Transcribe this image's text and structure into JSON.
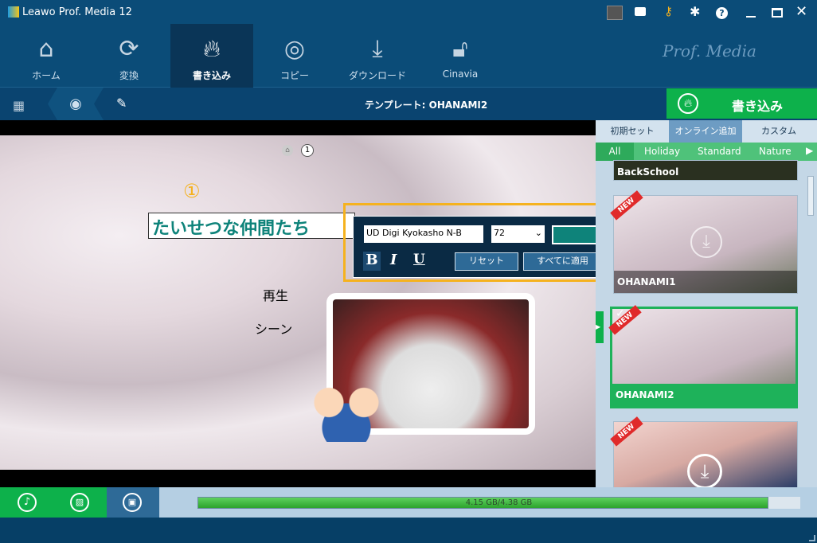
{
  "app": {
    "title": "Leawo Prof. Media 12",
    "brand": "Prof. Media"
  },
  "titlebar_icons": [
    "amd-badge-icon",
    "feedback-icon",
    "key-icon",
    "gear-icon",
    "help-icon",
    "minimize-icon",
    "maximize-icon",
    "close-icon"
  ],
  "nav": [
    {
      "label": "ホーム",
      "icon": "home-icon"
    },
    {
      "label": "変換",
      "icon": "convert-icon"
    },
    {
      "label": "書き込み",
      "icon": "burn-icon",
      "active": true
    },
    {
      "label": "コピー",
      "icon": "copy-disc-icon"
    },
    {
      "label": "ダウンロード",
      "icon": "download-icon"
    },
    {
      "label": "Cinavia",
      "icon": "cinavia-icon"
    }
  ],
  "toolbar": {
    "template_label": "テンプレート: OHANAMI2",
    "burn_label": "書き込み"
  },
  "canvas": {
    "breadcrumb_num": "1",
    "title_marker": "①",
    "title_text": "たいせつな仲間たち",
    "play_label": "再生",
    "scene_label": "シーン"
  },
  "font_editor": {
    "font": "UD Digi Kyokasho N-B",
    "size": "72",
    "color": "#0e837a",
    "bold": "B",
    "italic": "I",
    "underline": "U",
    "reset": "リセット",
    "apply_all": "すべてに適用"
  },
  "side": {
    "tabs": [
      "初期セット",
      "オンライン追加",
      "カスタム"
    ],
    "active_tab": 1,
    "categories": [
      "All",
      "Holiday",
      "Standard",
      "Nature"
    ],
    "templates": [
      {
        "name": "BackSchool"
      },
      {
        "name": "OHANAMI1",
        "badge": "NEW"
      },
      {
        "name": "OHANAMI2",
        "badge": "NEW",
        "selected": true
      },
      {
        "name": "",
        "badge": "NEW"
      }
    ]
  },
  "bottom": {
    "capacity": "4.15 GB/4.38 GB",
    "capacity_percent": 94.7
  },
  "colors": {
    "green": "#0db14b",
    "nav_bg": "#0b4c78",
    "accent_orange": "#f5b21f"
  }
}
